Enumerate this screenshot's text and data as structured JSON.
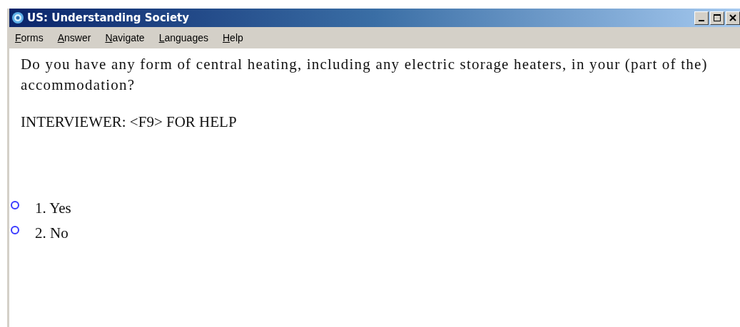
{
  "window": {
    "title": "US: Understanding Society"
  },
  "menu": [
    {
      "label": "Forms"
    },
    {
      "label": "Answer"
    },
    {
      "label": "Navigate"
    },
    {
      "label": "Languages"
    },
    {
      "label": "Help"
    }
  ],
  "question": "Do you have any form of central heating, including any electric storage heaters, in your (part of the) accommodation?",
  "instruction": "INTERVIEWER: <F9> FOR HELP",
  "options": [
    {
      "label": "1. Yes",
      "selected": false
    },
    {
      "label": "2. No",
      "selected": false
    }
  ]
}
